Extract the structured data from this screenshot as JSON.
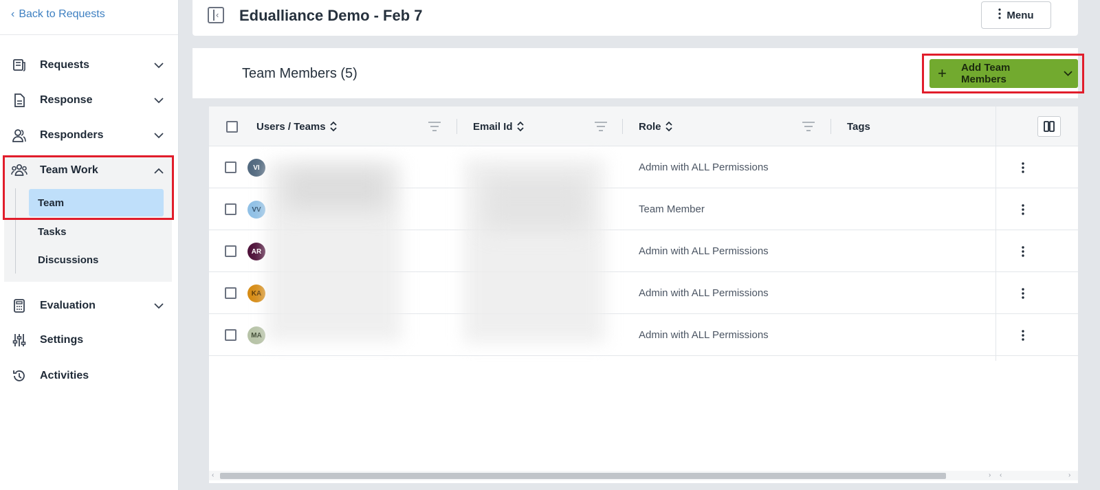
{
  "sidebar": {
    "back_label": "Back to Requests",
    "items": [
      {
        "label": "Requests",
        "icon": "requests-icon"
      },
      {
        "label": "Response",
        "icon": "document-icon"
      },
      {
        "label": "Responders",
        "icon": "users-icon"
      },
      {
        "label": "Team Work",
        "icon": "team-icon"
      },
      {
        "label": "Evaluation",
        "icon": "calculator-icon"
      },
      {
        "label": "Settings",
        "icon": "sliders-icon"
      },
      {
        "label": "Activities",
        "icon": "history-icon"
      }
    ],
    "teamwork_sub": [
      {
        "label": "Team",
        "active": true
      },
      {
        "label": "Tasks",
        "active": false
      },
      {
        "label": "Discussions",
        "active": false
      }
    ]
  },
  "header": {
    "title": "Edualliance Demo - Feb 7",
    "menu_label": "Menu"
  },
  "team": {
    "title": "Team Members (5)",
    "add_label": "Add Team Members"
  },
  "table": {
    "columns": [
      "Users / Teams",
      "Email Id",
      "Role",
      "Tags"
    ],
    "rows": [
      {
        "initials": "VI",
        "role": "Admin with ALL Permissions"
      },
      {
        "initials": "VV",
        "role": "Team Member"
      },
      {
        "initials": "AR",
        "role": "Admin with ALL Permissions"
      },
      {
        "initials": "KA",
        "role": "Admin with ALL Permissions"
      },
      {
        "initials": "MA",
        "role": "Admin with ALL Permissions"
      }
    ]
  },
  "colors": {
    "accent_green": "#72aa2f",
    "link_blue": "#3d7fc1",
    "active_sub_bg": "#bfdffa",
    "highlight_red": "#e11d2b",
    "avatar_vi": "#52697f",
    "avatar_vv": "#8fc0e6",
    "avatar_ar": "#4e1139",
    "avatar_ka": "#d68b14",
    "avatar_ma": "#b7c3a7"
  }
}
